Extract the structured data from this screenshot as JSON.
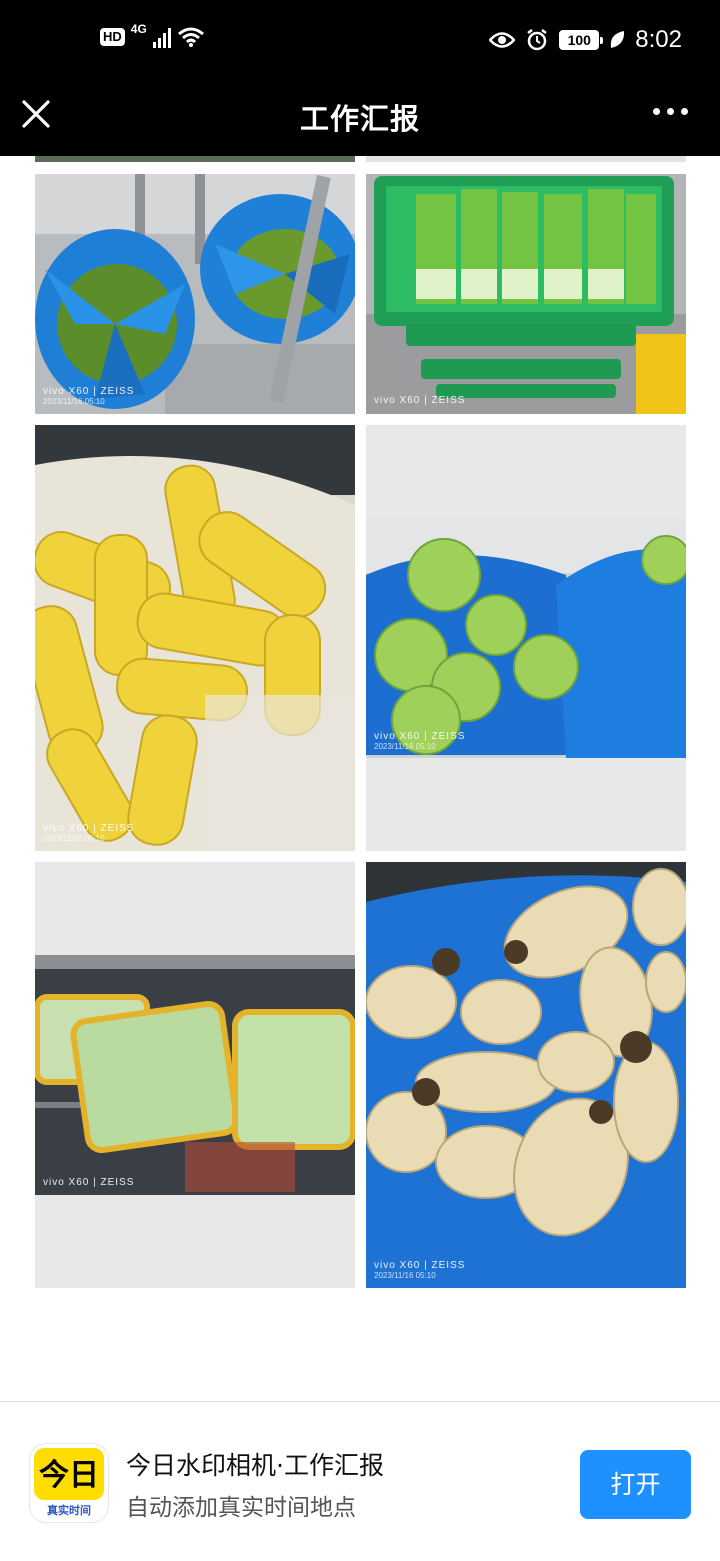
{
  "status_bar": {
    "hd": "HD",
    "network": "4G",
    "battery": "100",
    "time": "8:02",
    "icons": [
      "signal-icon",
      "wifi-icon",
      "eye-icon",
      "alarm-icon",
      "battery-icon",
      "leaf-icon"
    ]
  },
  "nav": {
    "title": "工作汇报",
    "close_icon": "close-icon",
    "more_icon": "more-icon"
  },
  "photos": [
    {
      "subject": "green beans in blue bags",
      "watermark_brand": "vivo X60 | ZEISS",
      "watermark_date": "2023/11/16 05:10"
    },
    {
      "subject": "green onions in green crates",
      "watermark_brand": "vivo X60 | ZEISS",
      "watermark_date": ""
    },
    {
      "subject": "sweet corn in plastic bag",
      "watermark_brand": "vivo X60 | ZEISS",
      "watermark_date": "2023/11/16 05:10"
    },
    {
      "subject": "cabbages in blue bags",
      "watermark_brand": "vivo X60 | ZEISS",
      "watermark_date": "2023/11/16 05:10"
    },
    {
      "subject": "napa cabbage packages on shelf",
      "watermark_brand": "vivo X60 | ZEISS",
      "watermark_date": ""
    },
    {
      "subject": "lotus roots in blue bag",
      "watermark_brand": "vivo X60 | ZEISS",
      "watermark_date": "2023/11/16 05:10"
    }
  ],
  "banner": {
    "icon_big_text": "今日",
    "icon_caption": "真实时间",
    "app_name": "今日水印相机·工作汇报",
    "app_subtitle": "自动添加真实时间地点",
    "open_label": "打开"
  },
  "colors": {
    "bar_bg": "#000000",
    "button_blue": "#1e90ff",
    "icon_yellow": "#ffdd00"
  }
}
